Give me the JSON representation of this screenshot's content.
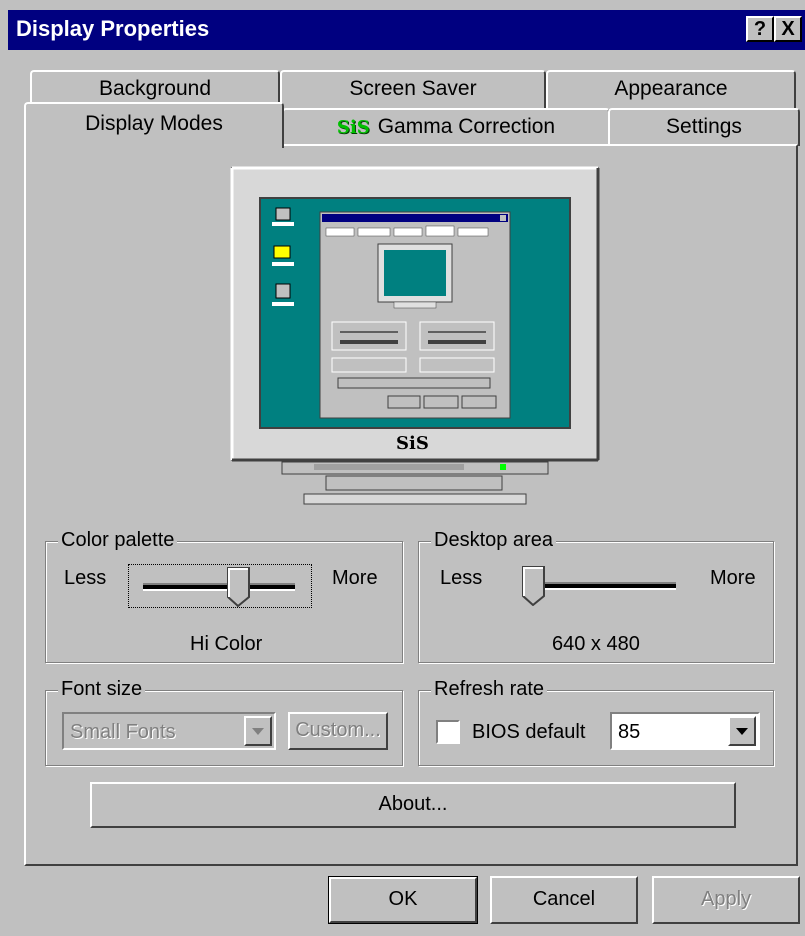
{
  "window": {
    "title": "Display Properties",
    "help_glyph": "?",
    "close_glyph": "X"
  },
  "tabs": {
    "row_back": [
      "Background",
      "Screen Saver",
      "Appearance"
    ],
    "row_front": [
      "Display Modes",
      "Gamma Correction",
      "Settings"
    ],
    "active": "Display Modes",
    "gamma_logo": "SiS"
  },
  "monitor": {
    "brand": "SiS",
    "screen_color": "#008080"
  },
  "color_palette": {
    "label": "Color palette",
    "less": "Less",
    "more": "More",
    "value": "Hi Color",
    "slider_position": 0.62
  },
  "desktop_area": {
    "label": "Desktop area",
    "less": "Less",
    "more": "More",
    "value": "640 x 480",
    "slider_position": 0.0
  },
  "font_size": {
    "label": "Font size",
    "selected": "Small Fonts",
    "custom_button": "Custom..."
  },
  "refresh_rate": {
    "label": "Refresh rate",
    "bios_default_label": "BIOS default",
    "bios_default_checked": false,
    "selected": "85"
  },
  "buttons": {
    "about": "About...",
    "ok": "OK",
    "cancel": "Cancel",
    "apply": "Apply"
  },
  "colors": {
    "titlebar": "#000080",
    "face": "#c0c0c0",
    "gamma_logo": "#00c000"
  }
}
